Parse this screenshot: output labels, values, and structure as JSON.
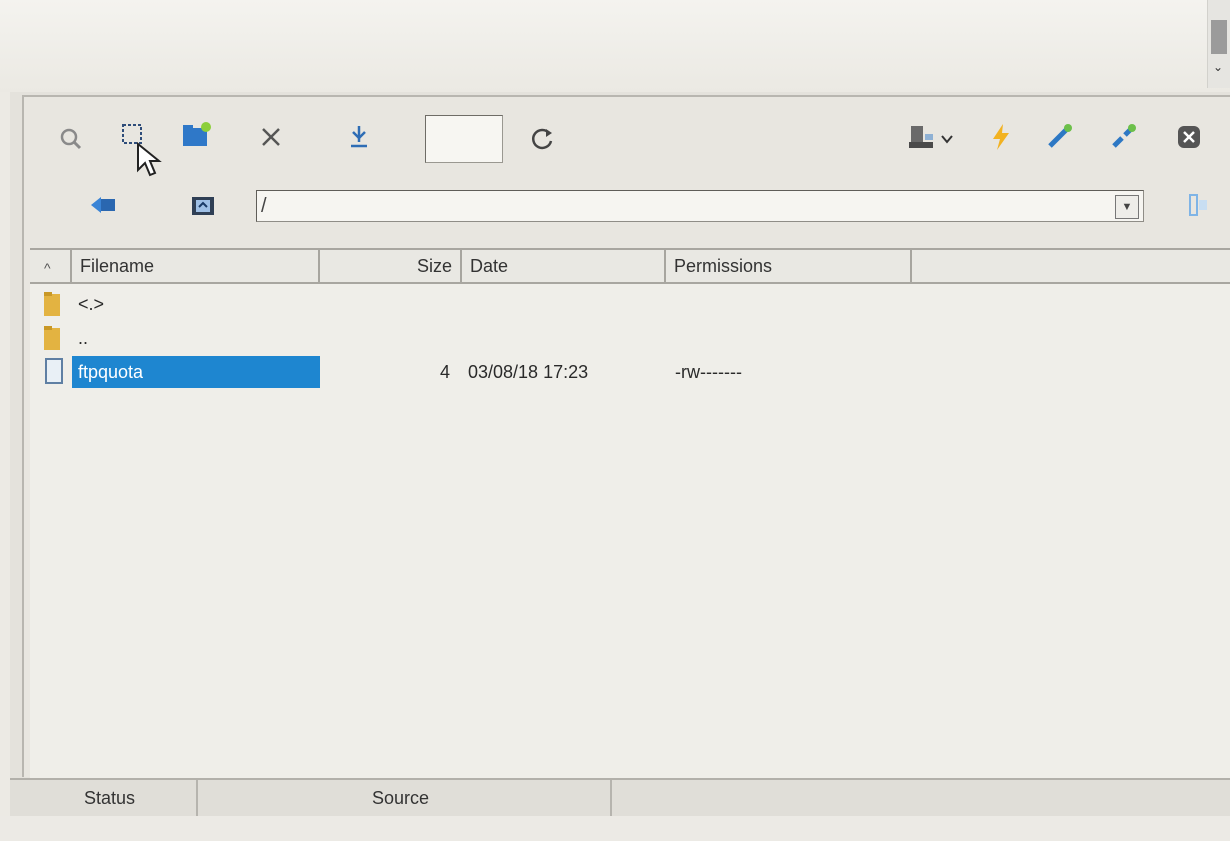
{
  "toolbar": {
    "count_value": "",
    "path_value": "/",
    "icons": [
      "search-icon",
      "select-icon",
      "new-folder-icon",
      "delete-icon",
      "download-icon",
      "refresh-icon",
      "server-icon",
      "chevron-down-icon",
      "lightning-icon",
      "connect-icon",
      "disconnect-icon",
      "close-icon",
      "back-icon",
      "parent-folder-icon",
      "split-view-icon"
    ]
  },
  "file_list": {
    "sort_indicator": "^",
    "columns": [
      "Filename",
      "Size",
      "Date",
      "Permissions"
    ],
    "rows": [
      {
        "name": "<.>",
        "size": "",
        "date": "",
        "permissions": "",
        "type": "folder"
      },
      {
        "name": "..",
        "size": "",
        "date": "",
        "permissions": "",
        "type": "folder"
      },
      {
        "name": "ftpquota",
        "size": "4",
        "date": "03/08/18 17:23",
        "permissions": "-rw-------",
        "type": "file",
        "selected": true
      }
    ]
  },
  "statusbar": {
    "status_label": "Status",
    "source_label": "Source"
  },
  "colors": {
    "selection": "#1e86d0",
    "background": "#efeee9"
  }
}
